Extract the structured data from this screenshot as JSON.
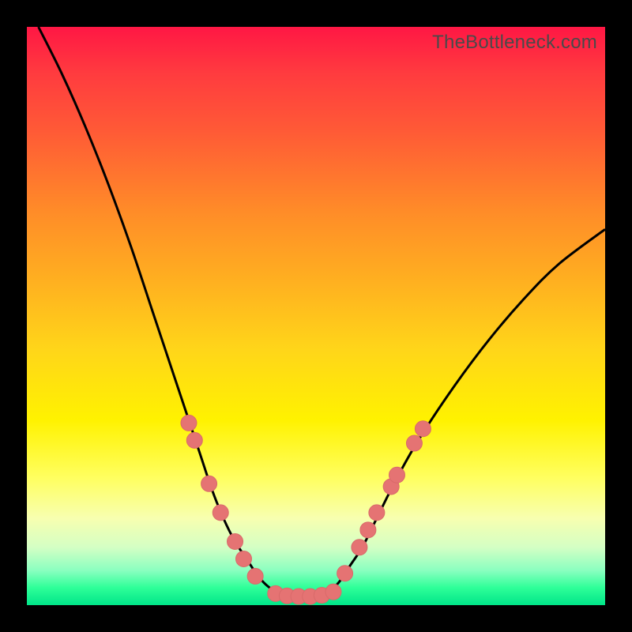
{
  "watermark": "TheBottleneck.com",
  "chart_data": {
    "type": "line",
    "title": "",
    "xlabel": "",
    "ylabel": "",
    "xlim": [
      0,
      100
    ],
    "ylim": [
      0,
      100
    ],
    "series": [
      {
        "name": "left-curve",
        "x": [
          2,
          6,
          10,
          14,
          18,
          22,
          26,
          28,
          30,
          32,
          34,
          36,
          38,
          40,
          42,
          44
        ],
        "y": [
          100,
          92,
          83,
          73,
          62,
          50,
          38,
          32,
          26,
          20,
          15,
          11,
          8,
          5,
          3,
          2
        ]
      },
      {
        "name": "valley-floor",
        "x": [
          44,
          46,
          48,
          50,
          52
        ],
        "y": [
          2,
          1.5,
          1.5,
          1.5,
          2
        ]
      },
      {
        "name": "right-curve",
        "x": [
          52,
          54,
          56,
          58,
          60,
          64,
          68,
          74,
          80,
          86,
          92,
          100
        ],
        "y": [
          2,
          4,
          7,
          10,
          14,
          22,
          29,
          38,
          46,
          53,
          59,
          65
        ]
      }
    ],
    "markers": [
      {
        "name": "left-markers",
        "points": [
          {
            "x": 28.0,
            "y": 31.5
          },
          {
            "x": 29.0,
            "y": 28.5
          },
          {
            "x": 31.5,
            "y": 21.0
          },
          {
            "x": 33.5,
            "y": 16.0
          },
          {
            "x": 36.0,
            "y": 11.0
          },
          {
            "x": 37.5,
            "y": 8.0
          },
          {
            "x": 39.5,
            "y": 5.0
          }
        ]
      },
      {
        "name": "floor-markers",
        "points": [
          {
            "x": 43.0,
            "y": 2.0
          },
          {
            "x": 45.0,
            "y": 1.6
          },
          {
            "x": 47.0,
            "y": 1.5
          },
          {
            "x": 49.0,
            "y": 1.5
          },
          {
            "x": 51.0,
            "y": 1.7
          },
          {
            "x": 53.0,
            "y": 2.3
          }
        ]
      },
      {
        "name": "right-markers",
        "points": [
          {
            "x": 55.0,
            "y": 5.5
          },
          {
            "x": 57.5,
            "y": 10.0
          },
          {
            "x": 59.0,
            "y": 13.0
          },
          {
            "x": 60.5,
            "y": 16.0
          },
          {
            "x": 63.0,
            "y": 20.5
          },
          {
            "x": 64.0,
            "y": 22.5
          },
          {
            "x": 67.0,
            "y": 28.0
          },
          {
            "x": 68.5,
            "y": 30.5
          }
        ]
      }
    ],
    "colors": {
      "curve": "#000000",
      "marker_fill": "#e57373",
      "marker_stroke": "#d96a6a"
    }
  }
}
